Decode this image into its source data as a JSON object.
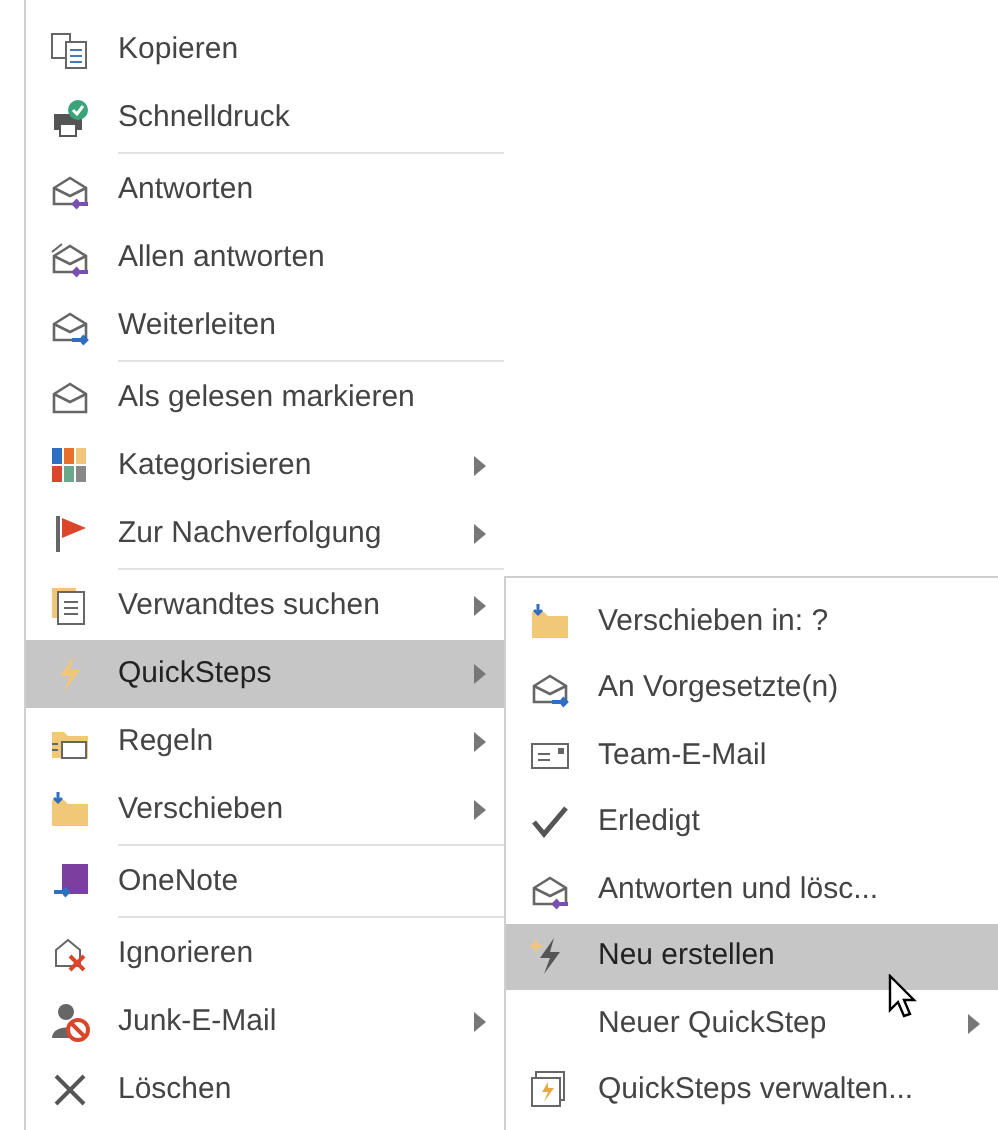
{
  "context_menu": {
    "groups": [
      {
        "items": [
          {
            "label": "Kopieren",
            "has_submenu": false,
            "selected": false
          },
          {
            "label": "Schnelldruck",
            "has_submenu": false,
            "selected": false
          }
        ]
      },
      {
        "items": [
          {
            "label": "Antworten",
            "has_submenu": false,
            "selected": false
          },
          {
            "label": "Allen antworten",
            "has_submenu": false,
            "selected": false
          },
          {
            "label": "Weiterleiten",
            "has_submenu": false,
            "selected": false
          }
        ]
      },
      {
        "items": [
          {
            "label": "Als gelesen markieren",
            "has_submenu": false,
            "selected": false
          },
          {
            "label": "Kategorisieren",
            "has_submenu": true,
            "selected": false
          },
          {
            "label": "Zur Nachverfolgung",
            "has_submenu": true,
            "selected": false
          }
        ]
      },
      {
        "items": [
          {
            "label": "Verwandtes suchen",
            "has_submenu": true,
            "selected": false
          },
          {
            "label": "QuickSteps",
            "has_submenu": true,
            "selected": true
          },
          {
            "label": "Regeln",
            "has_submenu": true,
            "selected": false
          },
          {
            "label": "Verschieben",
            "has_submenu": true,
            "selected": false
          }
        ]
      },
      {
        "items": [
          {
            "label": "OneNote",
            "has_submenu": false,
            "selected": false
          }
        ]
      },
      {
        "items": [
          {
            "label": "Ignorieren",
            "has_submenu": false,
            "selected": false
          },
          {
            "label": "Junk-E-Mail",
            "has_submenu": true,
            "selected": false
          },
          {
            "label": "Löschen",
            "has_submenu": false,
            "selected": false
          }
        ]
      }
    ]
  },
  "quicksteps_submenu": {
    "items": [
      {
        "label": "Verschieben in: ?",
        "has_submenu": false,
        "selected": false
      },
      {
        "label": "An Vorgesetzte(n)",
        "has_submenu": false,
        "selected": false
      },
      {
        "label": "Team-E-Mail",
        "has_submenu": false,
        "selected": false
      },
      {
        "label": "Erledigt",
        "has_submenu": false,
        "selected": false
      },
      {
        "label": "Antworten und lösc...",
        "has_submenu": false,
        "selected": false
      },
      {
        "label": "Neu erstellen",
        "has_submenu": false,
        "selected": true
      },
      {
        "label": "Neuer QuickStep",
        "has_submenu": true,
        "selected": false
      },
      {
        "label": "QuickSteps verwalten...",
        "has_submenu": false,
        "selected": false
      }
    ]
  }
}
